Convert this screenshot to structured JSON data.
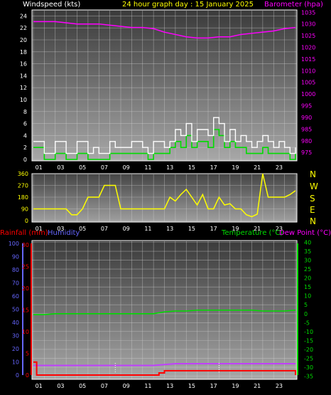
{
  "header": {
    "wind_label": "Windspeed (kts)",
    "title": "24 hour graph day : 15 January 2025",
    "baro_label": "Barometer (hpa)"
  },
  "colors": {
    "white": "#ffffff",
    "yellow": "#ffff00",
    "magenta": "#ff00ff",
    "green": "#00dd00",
    "light_green": "#66ff66",
    "red": "#ff0000",
    "blue": "#6666ff",
    "violet": "#c040ff"
  },
  "x_ticks": [
    "01",
    "03",
    "05",
    "07",
    "09",
    "11",
    "13",
    "15",
    "17",
    "19",
    "21",
    "23"
  ],
  "compass": [
    "N",
    "W",
    "S",
    "E",
    "N"
  ],
  "bottom_labels": {
    "rain": "Rainfall (mm)",
    "humidity": "Humidity",
    "temp": "Temperature (°C)",
    "dew": "Dew Point (°C)"
  },
  "chart_data": [
    {
      "type": "line",
      "series": [
        {
          "name": "Windspeed (kts)",
          "color": "white",
          "x": [
            0,
            0.5,
            1,
            1.5,
            2,
            2.5,
            3,
            3.5,
            4,
            4.5,
            5,
            5.5,
            6,
            6.5,
            7,
            7.5,
            8,
            8.5,
            9,
            9.5,
            10,
            10.5,
            11,
            11.5,
            12,
            12.5,
            13,
            13.5,
            14,
            14.5,
            15,
            15.5,
            16,
            16.5,
            17,
            17.5,
            18,
            18.5,
            19,
            19.5,
            20,
            20.5,
            21,
            21.5,
            22,
            22.5,
            23,
            23.5,
            24
          ],
          "y": [
            3,
            3,
            1,
            1,
            3,
            3,
            1,
            1,
            3,
            3,
            1,
            2,
            1,
            1,
            3,
            2,
            2,
            2,
            3,
            3,
            2,
            1,
            3,
            3,
            2,
            3,
            5,
            4,
            6,
            3,
            5,
            5,
            4,
            7,
            6,
            3,
            5,
            3,
            4,
            3,
            2,
            3,
            4,
            3,
            2,
            3,
            2,
            1,
            2
          ]
        },
        {
          "name": "Gust",
          "color": "green",
          "x": [
            0,
            0.5,
            1,
            1.5,
            2,
            2.5,
            3,
            3.5,
            4,
            4.5,
            5,
            5.5,
            6,
            6.5,
            7,
            7.5,
            8,
            8.5,
            9,
            9.5,
            10,
            10.5,
            11,
            11.5,
            12,
            12.5,
            13,
            13.5,
            14,
            14.5,
            15,
            15.5,
            16,
            16.5,
            17,
            17.5,
            18,
            18.5,
            19,
            19.5,
            20,
            20.5,
            21,
            21.5,
            22,
            22.5,
            23,
            23.5,
            24
          ],
          "y": [
            2,
            2,
            0,
            0,
            1,
            1,
            0,
            0,
            1,
            1,
            0,
            0,
            0,
            0,
            1,
            1,
            1,
            1,
            1,
            1,
            1,
            0,
            1,
            1,
            1,
            2,
            3,
            2,
            4,
            2,
            3,
            3,
            2,
            5,
            4,
            2,
            3,
            2,
            2,
            1,
            1,
            1,
            2,
            1,
            1,
            1,
            1,
            0,
            1
          ]
        }
      ],
      "ylim": [
        0,
        25
      ],
      "yticks": [
        0,
        2,
        4,
        6,
        8,
        10,
        12,
        14,
        16,
        18,
        20,
        22,
        24
      ]
    },
    {
      "type": "line",
      "series": [
        {
          "name": "Barometer (hpa)",
          "color": "magenta",
          "x": [
            0,
            1,
            2,
            3,
            4,
            5,
            6,
            7,
            8,
            9,
            10,
            11,
            12,
            13,
            14,
            15,
            16,
            17,
            18,
            19,
            20,
            21,
            22,
            23,
            24
          ],
          "y": [
            1031,
            1031,
            1031,
            1030.5,
            1030,
            1030,
            1030,
            1029.5,
            1029,
            1028.5,
            1028.5,
            1028,
            1026.5,
            1025.5,
            1024.5,
            1024,
            1024,
            1024.5,
            1024.5,
            1025.5,
            1026,
            1026.5,
            1027,
            1028,
            1028.5
          ]
        }
      ],
      "ylim": [
        972,
        1036
      ],
      "yticks": [
        975,
        980,
        985,
        990,
        995,
        1000,
        1005,
        1010,
        1015,
        1020,
        1025,
        1030,
        1035
      ]
    },
    {
      "type": "line",
      "series": [
        {
          "name": "Wind direction",
          "color": "yellow",
          "x": [
            0,
            1,
            2,
            3,
            3.5,
            4,
            4.5,
            5,
            5.5,
            6,
            6.5,
            7,
            7.5,
            8,
            9,
            10,
            11,
            12,
            12.5,
            13,
            13.5,
            14,
            14.5,
            15,
            15.5,
            16,
            16.5,
            17,
            17.5,
            18,
            18.5,
            19,
            19.5,
            20,
            20.5,
            21,
            21.5,
            22,
            22.5,
            23,
            23.5,
            24
          ],
          "y": [
            90,
            90,
            90,
            90,
            45,
            45,
            90,
            180,
            180,
            180,
            270,
            270,
            270,
            90,
            90,
            90,
            90,
            90,
            180,
            150,
            200,
            240,
            180,
            120,
            200,
            90,
            90,
            180,
            120,
            130,
            90,
            90,
            45,
            30,
            50,
            360,
            180,
            180,
            180,
            180,
            200,
            230
          ]
        }
      ],
      "ylim": [
        0,
        360
      ],
      "yticks": [
        0,
        90,
        180,
        270,
        360
      ]
    },
    {
      "type": "line",
      "series": [
        {
          "name": "Temperature (°C)",
          "color": "green",
          "x": [
            0,
            1,
            2,
            3,
            4,
            5,
            6,
            7,
            8,
            9,
            10,
            11,
            12,
            13,
            14,
            15,
            16,
            17,
            18,
            19,
            20,
            21,
            22,
            23,
            24
          ],
          "y": [
            -0.5,
            -0.5,
            0,
            0,
            0,
            0,
            0,
            0,
            0,
            0,
            0,
            0,
            1,
            1.5,
            1.5,
            2,
            2,
            2,
            2,
            2,
            2,
            1.5,
            1.5,
            1.5,
            2
          ]
        },
        {
          "name": "Dew Point (°C)",
          "color": "violet",
          "x": [
            0,
            1,
            2,
            3,
            4,
            5,
            6,
            7,
            8,
            9,
            10,
            11,
            12,
            13,
            14,
            15,
            16,
            17,
            18,
            19,
            20,
            21,
            22,
            23,
            24
          ],
          "y": [
            -29,
            -29,
            -29,
            -29,
            -29,
            -29,
            -29,
            -29,
            -29,
            -29,
            -29,
            -29,
            -28.5,
            -28,
            -28,
            -28,
            -28,
            -28,
            -28,
            -28,
            -28,
            -28,
            -28,
            -28,
            -28
          ]
        }
      ],
      "ylim": [
        -36,
        41
      ],
      "yticks": [
        -35,
        -30,
        -25,
        -20,
        -15,
        -10,
        -5,
        0,
        5,
        10,
        15,
        20,
        25,
        30,
        35,
        40
      ]
    },
    {
      "type": "line",
      "series": [
        {
          "name": "Rainfall (mm)",
          "color": "red",
          "x": [
            0,
            0.3,
            0.8,
            11.5,
            12,
            23.5,
            24
          ],
          "y": [
            3,
            0,
            0,
            0.5,
            1,
            1,
            0
          ]
        }
      ],
      "ylim": [
        0,
        31
      ],
      "yticks": [
        0,
        5,
        10,
        15,
        20,
        25,
        30
      ]
    },
    {
      "type": "line",
      "series": [
        {
          "name": "Humidity",
          "color": "blue"
        }
      ],
      "ylim": [
        0,
        100
      ],
      "yticks": [
        0,
        10,
        20,
        30,
        40,
        50,
        60,
        70,
        80,
        90,
        100
      ]
    }
  ]
}
